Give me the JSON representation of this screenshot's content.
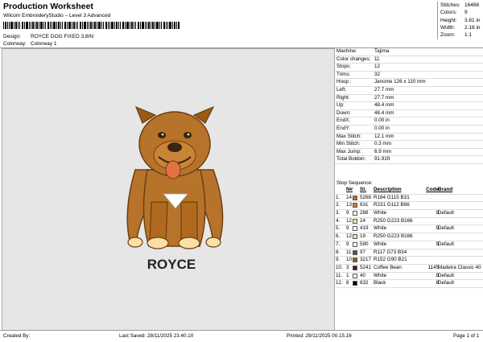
{
  "header": {
    "title": "Production Worksheet",
    "software": "Wilcom EmbroideryStudio – Level 3 Advanced",
    "design_label": "Design:",
    "design_value": "ROYCE DOG FIXED 3,8IN",
    "colorway_label": "Colorway:",
    "colorway_value": "Colorway 1"
  },
  "stats": {
    "stitches_label": "Stitches:",
    "stitches_value": "16468",
    "colors_label": "Colors:",
    "colors_value": "9",
    "height_label": "Height:",
    "height_value": "3.81 in",
    "width_label": "Width:",
    "width_value": "2.18 in",
    "zoom_label": "Zoom:",
    "zoom_value": "1:1"
  },
  "design_text": "ROYCE",
  "info": [
    {
      "k": "Machine:",
      "v": "Tajima"
    },
    {
      "k": "Color changes:",
      "v": "11"
    },
    {
      "k": "Stops:",
      "v": "12"
    },
    {
      "k": "Trims:",
      "v": "32"
    },
    {
      "k": "Hoop :",
      "v": "Janome 126 x 110 mm"
    },
    {
      "k": "Left:",
      "v": "27.7 mm"
    },
    {
      "k": "Right:",
      "v": "27.7 mm"
    },
    {
      "k": "Up:",
      "v": "48.4 mm"
    },
    {
      "k": "Down:",
      "v": "48.4 mm"
    },
    {
      "k": "EndX:",
      "v": "0.00 in"
    },
    {
      "k": "EndY:",
      "v": "0.00 in"
    },
    {
      "k": "Max Stitch:",
      "v": "12.1 mm"
    },
    {
      "k": "Min Stitch:",
      "v": "0.3 mm"
    },
    {
      "k": "Max Jump:",
      "v": "6.9 mm"
    },
    {
      "k": "Total Bobbin:",
      "v": "91.91ft"
    }
  ],
  "sequence": {
    "title": "Stop Sequence:",
    "headers": {
      "n": "N#",
      "st": "St.",
      "desc": "Description",
      "code": "Code",
      "brand": "Brand"
    },
    "rows": [
      {
        "i": "1.",
        "n": "14",
        "color": "#B87321",
        "st": "5268",
        "desc": "R184 G115 B31",
        "code": "",
        "brand": ""
      },
      {
        "i": "2.",
        "n": "13",
        "color": "#E77042",
        "st": "631",
        "desc": "R231 G112 B66",
        "code": "",
        "brand": ""
      },
      {
        "i": "3.",
        "n": "9",
        "color": "#FFFFFF",
        "st": "288",
        "desc": "White",
        "code": "9",
        "brand": "Default"
      },
      {
        "i": "4.",
        "n": "12",
        "color": "#FADFA6",
        "st": "24",
        "desc": "R250 G223 B166",
        "code": "",
        "brand": ""
      },
      {
        "i": "5.",
        "n": "9",
        "color": "#FFFFFF",
        "st": "419",
        "desc": "White",
        "code": "9",
        "brand": "Default"
      },
      {
        "i": "6.",
        "n": "12",
        "color": "#FADFA6",
        "st": "19",
        "desc": "R250 G223 B166",
        "code": "",
        "brand": ""
      },
      {
        "i": "7.",
        "n": "9",
        "color": "#FFFFFF",
        "st": "590",
        "desc": "White",
        "code": "9",
        "brand": "Default"
      },
      {
        "i": "8.",
        "n": "11",
        "color": "#75492E",
        "st": "97",
        "desc": "R117 G73 B34",
        "code": "",
        "brand": ""
      },
      {
        "i": "9.",
        "n": "10",
        "color": "#985A15",
        "st": "3217",
        "desc": "R152 G90 B21",
        "code": "",
        "brand": ""
      },
      {
        "i": "10.",
        "n": "3",
        "color": "#3A2412",
        "st": "5241",
        "desc": "Coffee Bean",
        "code": "1145",
        "brand": "Madeira Classic 40"
      },
      {
        "i": "11.",
        "n": "1",
        "color": "#FFFFFF",
        "st": "40",
        "desc": "White",
        "code": "9",
        "brand": "Default"
      },
      {
        "i": "12.",
        "n": "8",
        "color": "#000000",
        "st": "632",
        "desc": "Black",
        "code": "8",
        "brand": "Default"
      }
    ]
  },
  "footer": {
    "created_by": "Created By:",
    "last_saved": "Last Saved: 28/11/2025 23.40.10",
    "printed": "Printed: 29/11/2025 00.15.16",
    "page": "Page 1 of 1"
  }
}
